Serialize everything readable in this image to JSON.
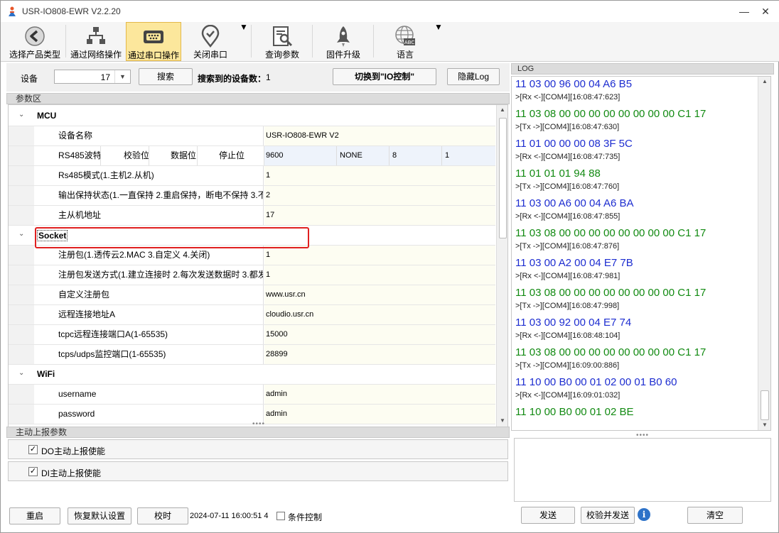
{
  "window": {
    "title": "USR-IO808-EWR V2.2.20",
    "minimize": "—",
    "close": "✕"
  },
  "toolbar": [
    {
      "label": "选择产品类型",
      "icon": "back-arrow-icon"
    },
    {
      "label": "通过网络操作",
      "icon": "network-icon"
    },
    {
      "label": "通过串口操作",
      "icon": "serial-port-icon",
      "active": true
    },
    {
      "label": "关闭串口",
      "icon": "location-check-icon"
    },
    {
      "label": "查询参数",
      "icon": "search-document-icon"
    },
    {
      "label": "固件升级",
      "icon": "rocket-icon"
    },
    {
      "label": "语言",
      "icon": "globe-abc-icon"
    }
  ],
  "device": {
    "label": "设备",
    "value": "17",
    "search_label": "搜索",
    "found_label": "搜索到的设备数：",
    "found_count": "1",
    "switch_label": "切换到\"IO控制\"",
    "hide_log_label": "隐藏Log"
  },
  "params": {
    "title": "参数区",
    "mcu": {
      "title": "MCU",
      "name_key": "设备名称",
      "name_val": "USR-IO808-EWR V2",
      "hdr": [
        "RS485波特率",
        "校验位",
        "数据位",
        "停止位"
      ],
      "hdrv": [
        "9600",
        "NONE",
        "8",
        "1"
      ],
      "mode_key": "Rs485模式(1.主机2.从机)",
      "mode_val": "1",
      "hold_key": "输出保持状态(1.一直保持 2.重启保持，断电不保持 3.不",
      "hold_val": "2",
      "addr_key": "主从机地址",
      "addr_val": "17"
    },
    "socket": {
      "title": "Socket",
      "rows": [
        {
          "k": "注册包(1.透传云2.MAC 3.自定义 4.关闭)",
          "v": "1"
        },
        {
          "k": "注册包发送方式(1.建立连接时 2.每次发送数据时 3.都发",
          "v": "1"
        },
        {
          "k": "自定义注册包",
          "v": "www.usr.cn"
        },
        {
          "k": "远程连接地址A",
          "v": "cloudio.usr.cn"
        },
        {
          "k": "tcpc远程连接端口A(1-65535)",
          "v": "15000"
        },
        {
          "k": "tcps/udps监控端口(1-65535)",
          "v": "28899"
        }
      ]
    },
    "wifi": {
      "title": "WiFi",
      "rows": [
        {
          "k": "username",
          "v": "admin"
        },
        {
          "k": "password",
          "v": "admin"
        }
      ]
    }
  },
  "report": {
    "title": "主动上报参数",
    "do_label": "DO主动上报使能",
    "di_label": "DI主动上报使能",
    "check": "✓"
  },
  "bottom": {
    "restart": "重启",
    "restore": "恢复默认设置",
    "sync": "校时",
    "time": "2024-07-11 16:00:51 4",
    "cond": "条件控制"
  },
  "log": {
    "title": "LOG",
    "lines": [
      {
        "t": "11 03 00 96 00 04 A6 B5",
        "c": "hexs"
      },
      {
        "t": ">[Rx <-][COM4][16:08:47:623]",
        "c": "meta"
      },
      {
        "t": "11 03 08 00 00 00 00 00 00 00 00 C1 17",
        "c": "hexr"
      },
      {
        "t": ">[Tx ->][COM4][16:08:47:630]",
        "c": "meta"
      },
      {
        "t": "11 01 00 00 00 08 3F 5C",
        "c": "hexs"
      },
      {
        "t": ">[Rx <-][COM4][16:08:47:735]",
        "c": "meta"
      },
      {
        "t": "11 01 01 01 94 88",
        "c": "hexr"
      },
      {
        "t": ">[Tx ->][COM4][16:08:47:760]",
        "c": "meta"
      },
      {
        "t": "11 03 00 A6 00 04 A6 BA",
        "c": "hexs"
      },
      {
        "t": ">[Rx <-][COM4][16:08:47:855]",
        "c": "meta"
      },
      {
        "t": "11 03 08 00 00 00 00 00 00 00 00 C1 17",
        "c": "hexr"
      },
      {
        "t": ">[Tx ->][COM4][16:08:47:876]",
        "c": "meta"
      },
      {
        "t": "11 03 00 A2 00 04 E7 7B",
        "c": "hexs"
      },
      {
        "t": ">[Rx <-][COM4][16:08:47:981]",
        "c": "meta"
      },
      {
        "t": "11 03 08 00 00 00 00 00 00 00 00 C1 17",
        "c": "hexr"
      },
      {
        "t": ">[Tx ->][COM4][16:08:47:998]",
        "c": "meta"
      },
      {
        "t": "11 03 00 92 00 04 E7 74",
        "c": "hexs"
      },
      {
        "t": ">[Rx <-][COM4][16:08:48:104]",
        "c": "meta"
      },
      {
        "t": "11 03 08 00 00 00 00 00 00 00 00 C1 17",
        "c": "hexr"
      },
      {
        "t": ">[Tx ->][COM4][16:09:00:886]",
        "c": "meta"
      },
      {
        "t": "11 10 00 B0 00 01 02 00 01 B0 60",
        "c": "hexs"
      },
      {
        "t": ">[Rx <-][COM4][16:09:01:032]",
        "c": "meta"
      },
      {
        "t": "11 10 00 B0 00 01 02 BE",
        "c": "hexr"
      }
    ],
    "send": "发送",
    "check_send": "校验并发送",
    "info": "i",
    "clear": "清空"
  }
}
